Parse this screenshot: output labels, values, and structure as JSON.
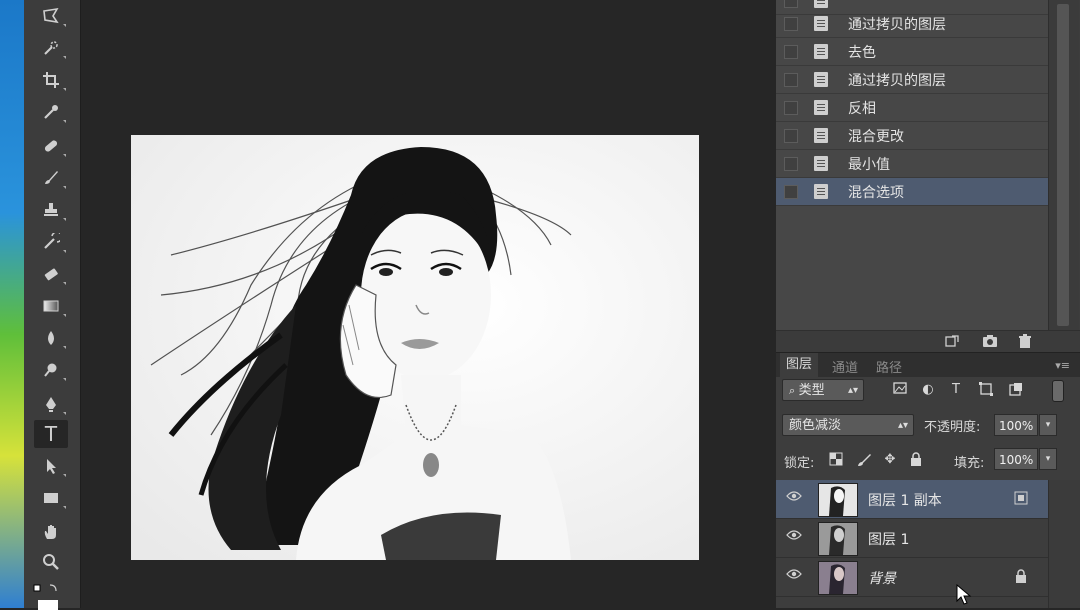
{
  "history": {
    "items": [
      {
        "label": "通过拷贝的图层",
        "selected": false
      },
      {
        "label": "去色",
        "selected": false
      },
      {
        "label": "通过拷贝的图层",
        "selected": false
      },
      {
        "label": "反相",
        "selected": false
      },
      {
        "label": "混合更改",
        "selected": false
      },
      {
        "label": "最小值",
        "selected": false
      },
      {
        "label": "混合选项",
        "selected": true
      }
    ]
  },
  "layers_panel": {
    "tabs": [
      "图层",
      "通道",
      "路径"
    ],
    "filter_type": "类型",
    "blend_mode": "颜色减淡",
    "opacity_label": "不透明度:",
    "opacity_value": "100%",
    "lock_label": "锁定:",
    "fill_label": "填充:",
    "fill_value": "100%",
    "layers": [
      {
        "name": "图层 1 副本",
        "selected": true
      },
      {
        "name": "图层 1",
        "selected": false
      },
      {
        "name": "背景",
        "selected": false,
        "locked": true
      }
    ]
  },
  "tools": {
    "active": "type-tool",
    "type_glyph": "T"
  }
}
